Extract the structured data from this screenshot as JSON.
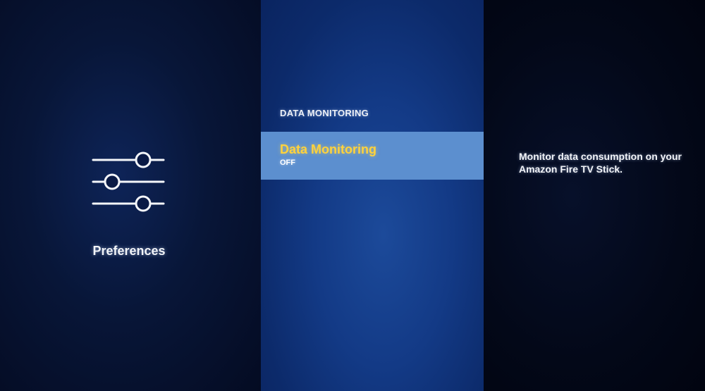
{
  "left_panel": {
    "icon": "sliders-icon",
    "label": "Preferences"
  },
  "middle_panel": {
    "section_title": "DATA MONITORING",
    "items": [
      {
        "label": "Data Monitoring",
        "value": "OFF",
        "selected": true
      }
    ]
  },
  "right_panel": {
    "description": "Monitor data consumption on your Amazon Fire TV Stick."
  },
  "colors": {
    "selected_highlight": "#5c8fcf",
    "selected_text": "#ffd23c",
    "text": "#f2f4f8"
  }
}
